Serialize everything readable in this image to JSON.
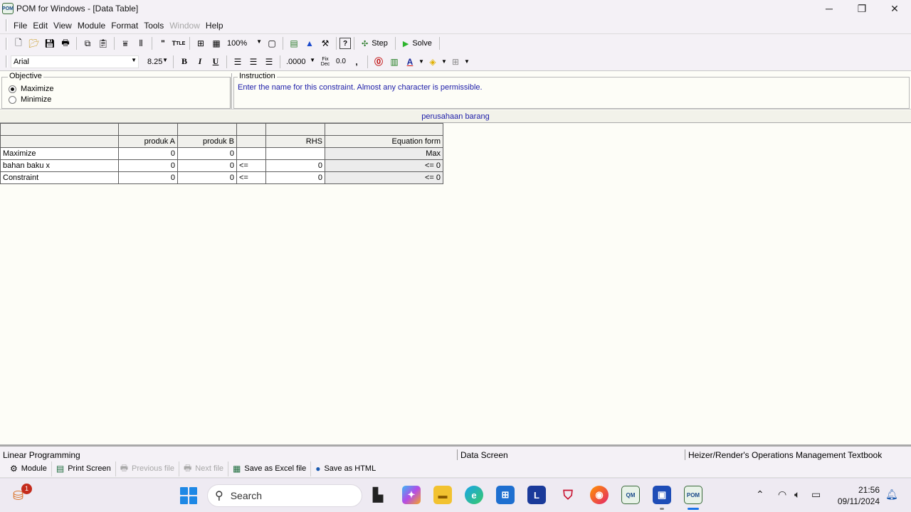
{
  "window": {
    "title": "POM for Windows - [Data Table]",
    "app_icon_text": "POM",
    "controls": {
      "minimize": "─",
      "maximize": "❐",
      "close": "✕"
    }
  },
  "menu": [
    {
      "label": "File",
      "disabled": false
    },
    {
      "label": "Edit",
      "disabled": false
    },
    {
      "label": "View",
      "disabled": false
    },
    {
      "label": "Module",
      "disabled": false
    },
    {
      "label": "Format",
      "disabled": false
    },
    {
      "label": "Tools",
      "disabled": false
    },
    {
      "label": "Window",
      "disabled": true
    },
    {
      "label": "Help",
      "disabled": false
    }
  ],
  "toolbar": {
    "zoom": "100%",
    "step_label": "Step",
    "solve_label": "Solve",
    "font_name": "Arial",
    "font_size": "8.25",
    "bold": "B",
    "italic": "I",
    "underline": "U",
    "number_format": ".0000",
    "fix_dec": "Fix Dec",
    "zero_dec": "0.0",
    "comma": ","
  },
  "objective": {
    "label": "Objective",
    "options": [
      {
        "label": "Maximize",
        "checked": true
      },
      {
        "label": "Minimize",
        "checked": false
      }
    ]
  },
  "instruction": {
    "label": "Instruction",
    "text": "Enter the name for this constraint. Almost any character is permissible."
  },
  "problem_title": "perusahaan barang",
  "table": {
    "headers": [
      "",
      "produk A",
      "produk B",
      "",
      "RHS",
      "Equation form"
    ],
    "rows": [
      {
        "name": "Maximize",
        "a": "0",
        "b": "0",
        "sign": "",
        "rhs": "",
        "form": "Max"
      },
      {
        "name": "bahan baku x",
        "a": "0",
        "b": "0",
        "sign": "<=",
        "rhs": "0",
        "form": "<= 0"
      },
      {
        "name": "Constraint",
        "a": "0",
        "b": "0",
        "sign": "<=",
        "rhs": "0",
        "form": "<= 0"
      }
    ]
  },
  "status": {
    "module": "Linear Programming",
    "screen": "Data Screen",
    "textbook": "Heizer/Render's Operations Management Textbook"
  },
  "bottom_buttons": [
    {
      "label": "Module",
      "disabled": false,
      "icon": "module-icon"
    },
    {
      "label": "Print Screen",
      "disabled": false,
      "icon": "print-icon"
    },
    {
      "label": "Previous file",
      "disabled": true,
      "icon": "previous-file-icon"
    },
    {
      "label": "Next file",
      "disabled": true,
      "icon": "next-file-icon"
    },
    {
      "label": "Save as Excel file",
      "disabled": false,
      "icon": "excel-icon"
    },
    {
      "label": "Save as HTML",
      "disabled": false,
      "icon": "globe-icon"
    }
  ],
  "taskbar": {
    "notification_count": "1",
    "search_placeholder": "Search",
    "time": "21:56",
    "date": "09/11/2024"
  }
}
